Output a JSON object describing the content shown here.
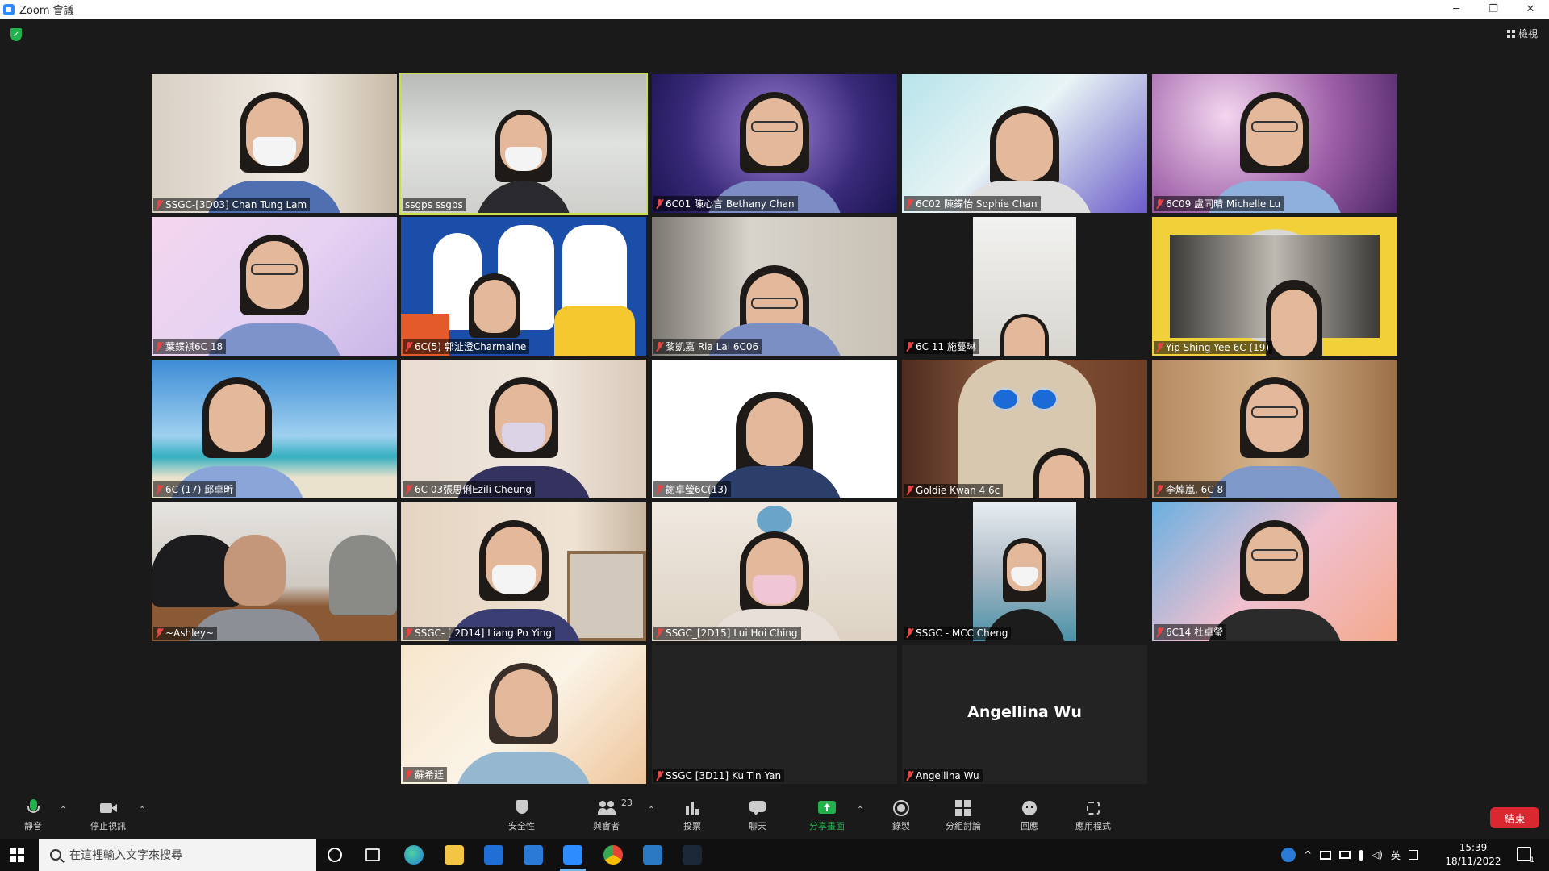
{
  "window": {
    "title": "Zoom 會議",
    "minimize": "─",
    "restore": "❐",
    "close": "✕"
  },
  "top": {
    "view_label": "檢視"
  },
  "participants": [
    {
      "name": "SSGC-[3D03] Chan Tung Lam",
      "muted": true
    },
    {
      "name": "ssgps ssgps",
      "muted": false,
      "active_speaker": true
    },
    {
      "name": "6C01 陳心言 Bethany Chan",
      "muted": true
    },
    {
      "name": "6C02 陳鍱怡 Sophie Chan",
      "muted": true
    },
    {
      "name": "6C09 盧同晴 Michelle Lu",
      "muted": true
    },
    {
      "name": "葉鍱祺6C 18",
      "muted": true
    },
    {
      "name": "6C(5) 郭沚澄Charmaine",
      "muted": true
    },
    {
      "name": "黎凱嘉 Ria Lai 6C06",
      "muted": true
    },
    {
      "name": "6C 11 施蔓琳",
      "muted": true
    },
    {
      "name": "Yip Shing Yee 6C (19)",
      "muted": true
    },
    {
      "name": "6C (17) 邱卓昕",
      "muted": true
    },
    {
      "name": "6C 03張思俐Ezili Cheung",
      "muted": true
    },
    {
      "name": "謝卓瑩6C(13)",
      "muted": true
    },
    {
      "name": "Goldie Kwan 4 6c",
      "muted": true
    },
    {
      "name": "李焯嵐, 6C 8",
      "muted": true
    },
    {
      "name": "~Ashley~",
      "muted": true
    },
    {
      "name": "SSGC- [ 2D14] Liang Po Ying",
      "muted": true
    },
    {
      "name": "SSGC_[2D15] Lui Hoi Ching",
      "muted": true
    },
    {
      "name": "SSGC - MCC Cheng",
      "muted": true
    },
    {
      "name": "6C14 杜卓瑩",
      "muted": true
    },
    {
      "name": "蘇希廷",
      "muted": true
    },
    {
      "name": "SSGC [3D11] Ku Tin Yan",
      "muted": true
    },
    {
      "name": "Angellina Wu",
      "muted": true,
      "video_off": true
    }
  ],
  "toolbar": {
    "mute": "靜音",
    "stop_video": "停止視訊",
    "security": "安全性",
    "participants": "與會者",
    "participant_count": "23",
    "polls": "投票",
    "chat": "聊天",
    "share": "分享畫面",
    "record": "錄製",
    "breakout": "分組討論",
    "reactions": "回應",
    "apps": "應用程式",
    "end": "結束"
  },
  "taskbar": {
    "search_placeholder": "在這裡輸入文字來搜尋",
    "ime": "英",
    "time": "15:39",
    "date": "18/11/2022",
    "notification_count": "1"
  },
  "colors": {
    "accent_share": "#23b14d",
    "end": "#d9282f",
    "active_outline": "#c9e04a",
    "muted_mic": "#e84545"
  }
}
